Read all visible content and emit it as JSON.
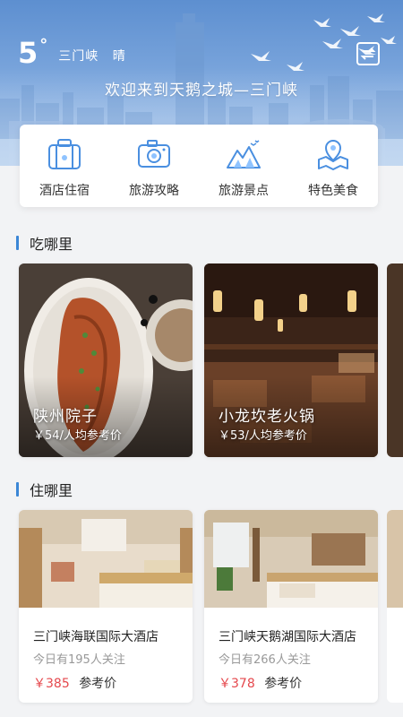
{
  "header": {
    "temperature": "5",
    "degree": "°",
    "city": "三门峡",
    "condition": "晴",
    "welcome": "欢迎来到天鹅之城—三门峡"
  },
  "categories": [
    {
      "label": "酒店住宿",
      "icon": "luggage-icon"
    },
    {
      "label": "旅游攻略",
      "icon": "camera-icon"
    },
    {
      "label": "旅游景点",
      "icon": "mountain-icon"
    },
    {
      "label": "特色美食",
      "icon": "map-pin-icon"
    }
  ],
  "eat": {
    "title": "吃哪里",
    "items": [
      {
        "name": "陕州院子",
        "price": "￥54/人均参考价"
      },
      {
        "name": "小龙坎老火锅",
        "price": "￥53/人均参考价"
      }
    ]
  },
  "stay": {
    "title": "住哪里",
    "items": [
      {
        "name": "三门峡海联国际大酒店",
        "follow": "今日有195人关注",
        "price": "￥385",
        "ref": "参考价"
      },
      {
        "name": "三门峡天鹅湖国际大酒店",
        "follow": "今日有266人关注",
        "price": "￥378",
        "ref": "参考价"
      }
    ]
  },
  "colors": {
    "accent": "#3b86d6",
    "price": "#e5484d",
    "icon": "#4a8fe0"
  }
}
